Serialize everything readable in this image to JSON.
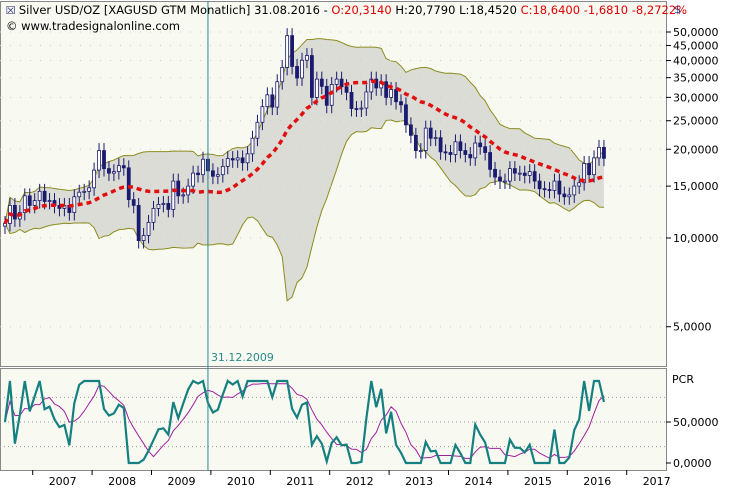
{
  "header": {
    "symbol": "Silver USD/OZ [XAGUSD GTM  Monatlich]",
    "date": "31.08.2016",
    "dash": "-",
    "open": "O:20,3140",
    "high": "H:20,7790",
    "low": "L:18,4520",
    "close": "C:18,6400",
    "change": "-1,6810",
    "change_pct": "-8,2722%"
  },
  "copyright": "© www.tradesignalonline.com",
  "marker": {
    "label": "31.12.2009",
    "index": 41
  },
  "colors": {
    "bg": "#f8faf2",
    "band_fill": "#dcdcd6",
    "band_line": "#8c8c1e",
    "ma": "#e01010",
    "candle": "#1a1a6e",
    "pcr": "#168080",
    "signal": "#a020a0"
  },
  "chart_data": {
    "type": "candlestick",
    "title": "Silver USD/OZ monthly",
    "start": "2006-07",
    "interval": "month",
    "close": [
      11.2,
      12.9,
      11.6,
      12.2,
      13.9,
      12.9,
      13.4,
      14.4,
      13.3,
      13.4,
      12.9,
      12.6,
      12.9,
      12.2,
      13.8,
      14.3,
      14.4,
      14.8,
      17.0,
      19.8,
      17.2,
      16.6,
      16.8,
      17.6,
      17.3,
      13.5,
      12.9,
      9.8,
      10.2,
      11.3,
      12.6,
      13.0,
      13.1,
      12.5,
      15.6,
      13.9,
      14.0,
      15.0,
      16.6,
      16.4,
      18.5,
      16.9,
      16.2,
      16.4,
      17.5,
      18.6,
      18.4,
      18.7,
      18.0,
      19.3,
      21.8,
      24.7,
      27.9,
      30.6,
      27.8,
      33.9,
      37.9,
      48.6,
      38.2,
      34.9,
      40.1,
      41.6,
      30.0,
      34.6,
      32.7,
      28.2,
      33.2,
      34.6,
      32.6,
      31.2,
      27.5,
      27.4,
      27.6,
      31.3,
      34.6,
      32.3,
      33.9,
      30.0,
      31.9,
      29.0,
      28.3,
      24.2,
      22.3,
      19.8,
      19.8,
      23.6,
      21.8,
      21.9,
      19.6,
      19.5,
      19.2,
      21.2,
      19.8,
      19.2,
      18.7,
      21.0,
      20.4,
      19.5,
      17.1,
      16.1,
      15.6,
      15.6,
      17.2,
      16.6,
      16.6,
      16.3,
      16.8,
      15.6,
      14.7,
      14.6,
      14.5,
      15.6,
      14.1,
      13.8,
      14.0,
      15.0,
      15.4,
      17.9,
      16.4,
      18.7,
      20.3,
      18.64
    ],
    "y_unit": "$",
    "y_scale": "log",
    "y_ticks": [
      "50,0000",
      "45,0000",
      "40,0000",
      "35,0000",
      "30,0000",
      "25,0000",
      "20,0000",
      "15,0000",
      "10,0000",
      "5,0000"
    ],
    "y_tick_values": [
      50,
      45,
      40,
      35,
      30,
      25,
      20,
      15,
      10,
      5
    ],
    "x_ticks": [
      "2007",
      "2008",
      "2009",
      "2010",
      "2011",
      "2012",
      "2013",
      "2014",
      "2015",
      "2016",
      "2017"
    ],
    "indicators": [
      "Moving average",
      "Bollinger bands"
    ],
    "lower_panel": {
      "label": "PCR",
      "y_ticks": [
        "50,0000",
        "0,0000"
      ],
      "y_tick_values": [
        50,
        0
      ]
    }
  }
}
